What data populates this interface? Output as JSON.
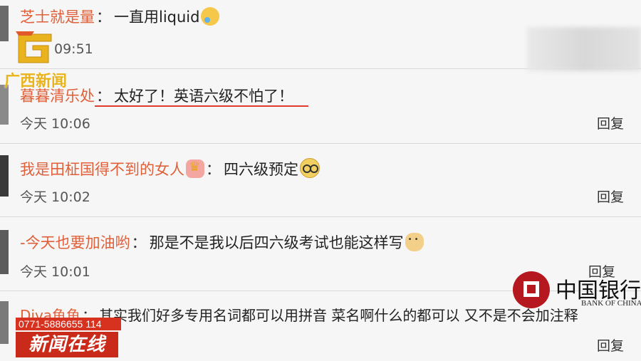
{
  "comments": [
    {
      "user": "芝士就是量",
      "sep": "：",
      "text": "一直用liquid",
      "emoji": "cry-laugh-icon",
      "time": "09:51"
    },
    {
      "user": "暮暮清乐处",
      "sep": "：",
      "text": "太好了！英语六级不怕了！",
      "time": "今天 10:06",
      "reply": "回复"
    },
    {
      "user": "我是田柾国得不到的女人",
      "sep": "：",
      "text": "四六级预定",
      "emoji": "glasses-icon",
      "time": "今天 10:02",
      "reply": "回复"
    },
    {
      "user": "-今天也要加油哟",
      "sep": "：",
      "text": "那是不是我以后四六级考试也能这样写",
      "emoji": "doge-icon",
      "time": "今天 10:01",
      "reply": "回复"
    },
    {
      "user": "Diva鱼鱼",
      "sep": "：",
      "text": "其实我们好多专用名词都可以用拼音 菜名啊什么的都可以 又不是不会加注释",
      "reply": "回复"
    }
  ],
  "overlay": {
    "station_logo_text": "广西新闻",
    "phone": "0771-5886655 114",
    "program": "新闻在线",
    "sponsor_cn": "中国银行",
    "sponsor_en": "BANK OF CHINA"
  },
  "colors": {
    "username": "#e0603a",
    "underline": "#e23b2f",
    "banner": "#c92a19",
    "boc": "#b5191f"
  }
}
